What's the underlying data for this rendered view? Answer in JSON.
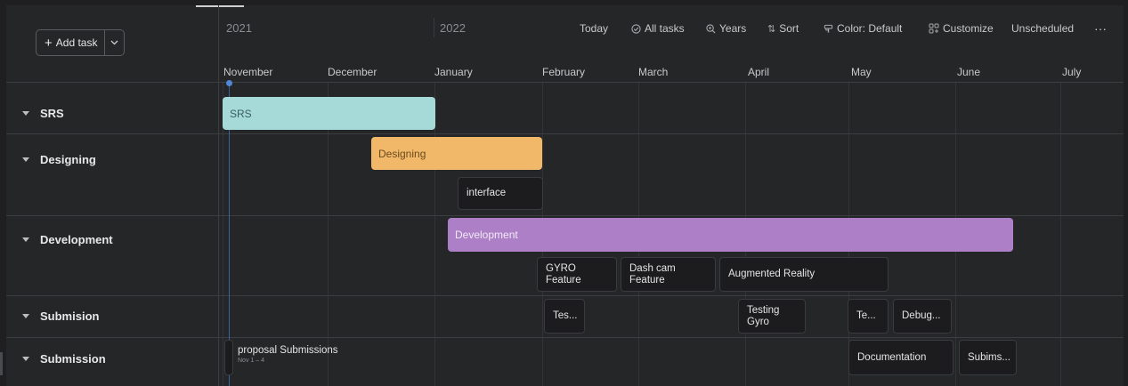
{
  "toolbar": {
    "add_task": "Add task",
    "today": "Today",
    "all_tasks": "All tasks",
    "years": "Years",
    "sort": "Sort",
    "color": "Color: Default",
    "customize": "Customize",
    "unscheduled": "Unscheduled",
    "more": "···"
  },
  "years": [
    "2021",
    "2022"
  ],
  "months": [
    "November",
    "December",
    "January",
    "February",
    "March",
    "April",
    "May",
    "June",
    "July"
  ],
  "groups": [
    "SRS",
    "Designing",
    "Development",
    "Submision",
    "Submission"
  ],
  "bars": {
    "srs": "SRS",
    "designing": "Designing",
    "development": "Development"
  },
  "tasks": {
    "interface": "interface",
    "gyro_l1": "GYRO",
    "gyro_l2": "Feature",
    "dashcam_l1": "Dash cam",
    "dashcam_l2": "Feature",
    "ar": "Augmented Reality",
    "tes": "Tes...",
    "testing_gyro_l1": "Testing",
    "testing_gyro_l2": "Gyro",
    "te": "Te...",
    "debug": "Debug...",
    "proposal": "proposal Submissions",
    "proposal_dates": "Nov 1 – 4",
    "documentation": "Documentation",
    "subims": "Subims..."
  },
  "colors": {
    "srs": "#a6dad8",
    "designing": "#f1b86a",
    "development": "#ad7fc6",
    "today_marker": "#4f86d6"
  }
}
